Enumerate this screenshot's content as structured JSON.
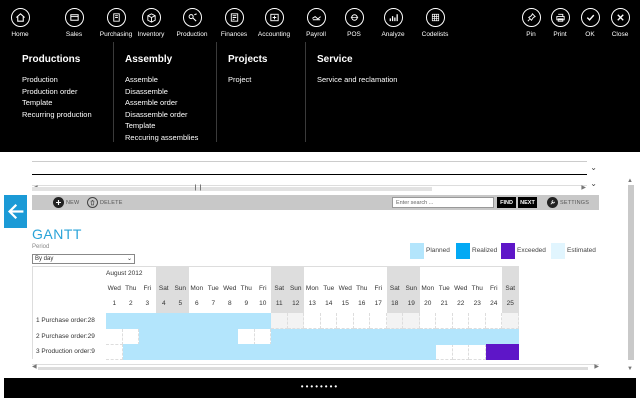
{
  "topbar": {
    "left": [
      {
        "label": "Home",
        "icon": "home-icon"
      },
      {
        "label": "Sales",
        "icon": "sales-icon"
      },
      {
        "label": "Purchasing",
        "icon": "purchasing-icon"
      },
      {
        "label": "Inventory",
        "icon": "inventory-icon"
      },
      {
        "label": "Production",
        "icon": "production-icon"
      },
      {
        "label": "Finances",
        "icon": "finances-icon"
      },
      {
        "label": "Accounting",
        "icon": "accounting-icon"
      },
      {
        "label": "Payroll",
        "icon": "payroll-icon"
      },
      {
        "label": "POS",
        "icon": "pos-icon"
      },
      {
        "label": "Analyze",
        "icon": "analyze-icon"
      },
      {
        "label": "Codelists",
        "icon": "codelists-icon"
      }
    ],
    "right": [
      {
        "label": "Pin",
        "icon": "pin-icon"
      },
      {
        "label": "Print",
        "icon": "print-icon"
      },
      {
        "label": "OK",
        "icon": "ok-icon"
      },
      {
        "label": "Close",
        "icon": "close-icon"
      }
    ]
  },
  "megamenu": {
    "columns": [
      {
        "title": "Productions",
        "items": [
          "Production",
          "Production order",
          "Template",
          "Recurring production"
        ]
      },
      {
        "title": "Assembly",
        "items": [
          "Assemble",
          "Disassemble",
          "Assemble order",
          "Disassemble order",
          "Template",
          "Reccuring assemblies"
        ]
      },
      {
        "title": "Projects",
        "items": [
          "Project"
        ]
      },
      {
        "title": "Service",
        "items": [
          "Service and reclamation"
        ]
      }
    ]
  },
  "toolbar": {
    "new_label": "NEW",
    "delete_label": "DELETE",
    "search_placeholder": "Enter search ...",
    "find_label": "FIND",
    "next_label": "NEXT",
    "settings_label": "SETTINGS"
  },
  "gantt": {
    "title": "GANTT",
    "period_label": "Period",
    "period_value": "By day",
    "month": "August 2012",
    "days": [
      {
        "d": "Wed",
        "n": "1"
      },
      {
        "d": "Thu",
        "n": "2"
      },
      {
        "d": "Fri",
        "n": "3"
      },
      {
        "d": "Sat",
        "n": "4"
      },
      {
        "d": "Sun",
        "n": "5"
      },
      {
        "d": "Mon",
        "n": "6"
      },
      {
        "d": "Tue",
        "n": "7"
      },
      {
        "d": "Wed",
        "n": "8"
      },
      {
        "d": "Thu",
        "n": "9"
      },
      {
        "d": "Fri",
        "n": "10"
      },
      {
        "d": "Sat",
        "n": "11"
      },
      {
        "d": "Sun",
        "n": "12"
      },
      {
        "d": "Mon",
        "n": "13"
      },
      {
        "d": "Tue",
        "n": "14"
      },
      {
        "d": "Wed",
        "n": "15"
      },
      {
        "d": "Thu",
        "n": "16"
      },
      {
        "d": "Fri",
        "n": "17"
      },
      {
        "d": "Sat",
        "n": "18"
      },
      {
        "d": "Sun",
        "n": "19"
      },
      {
        "d": "Mon",
        "n": "20"
      },
      {
        "d": "Tue",
        "n": "21"
      },
      {
        "d": "Wed",
        "n": "22"
      },
      {
        "d": "Thu",
        "n": "23"
      },
      {
        "d": "Fri",
        "n": "24"
      },
      {
        "d": "Sat",
        "n": "25"
      }
    ],
    "legend": [
      {
        "label": "Planned",
        "color": "#b3e5fc"
      },
      {
        "label": "Realized",
        "color": "#03a9f4"
      },
      {
        "label": "Exceeded",
        "color": "#5e16c8"
      },
      {
        "label": "Estimated",
        "color": "#e1f5fe"
      }
    ],
    "rows": [
      {
        "label": "1  Purchase order:28",
        "segments": [
          {
            "from": 1,
            "to": 10,
            "status": "Planned"
          }
        ]
      },
      {
        "label": "2  Purchase order:29",
        "segments": [
          {
            "from": 3,
            "to": 8,
            "status": "Planned"
          },
          {
            "from": 11,
            "to": 25,
            "status": "Planned"
          }
        ]
      },
      {
        "label": "3  Production order:9",
        "segments": [
          {
            "from": 2,
            "to": 20,
            "status": "Planned"
          },
          {
            "from": 24,
            "to": 25,
            "status": "Exceeded"
          }
        ]
      }
    ]
  },
  "colors": {
    "accent": "#29a3d8",
    "planned": "#b3e5fc",
    "exceeded": "#5e16c8",
    "weekend": "#dddddd"
  }
}
